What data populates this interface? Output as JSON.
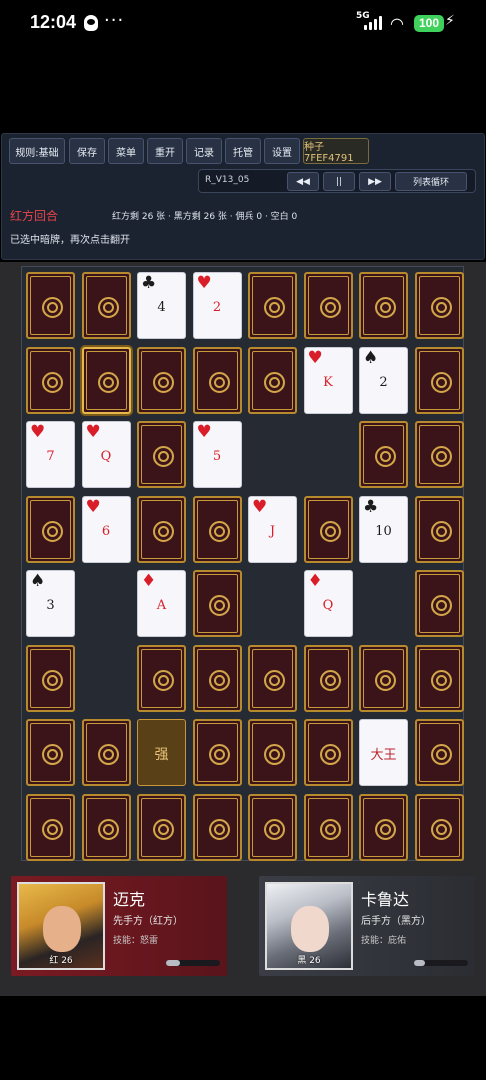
{
  "status": {
    "time": "12:04",
    "network": "5G",
    "battery": "100",
    "more": "···"
  },
  "toolbar": {
    "buttons": [
      "规则:基础",
      "保存",
      "菜单",
      "重开",
      "记录",
      "托管",
      "设置"
    ],
    "seed": "种子 7FEF4791"
  },
  "controls": {
    "version": "R_V13_05",
    "rewind": "◀◀",
    "pause": "||",
    "forward": "▶▶",
    "loop": "列表循环"
  },
  "info": {
    "turn": "红方回合",
    "counts": "红方剩 26 张 · 黑方剩 26 张 · 佣兵 0 · 空白 0",
    "message": "已选中暗牌，再次点击翻开"
  },
  "board": {
    "rows": [
      [
        {
          "t": "back"
        },
        {
          "t": "back"
        },
        {
          "t": "face",
          "suit": "♣",
          "rank": "4",
          "color": "black"
        },
        {
          "t": "face",
          "suit": "♥",
          "rank": "2",
          "color": "red"
        },
        {
          "t": "back"
        },
        {
          "t": "back"
        },
        {
          "t": "back"
        },
        {
          "t": "back"
        }
      ],
      [
        {
          "t": "back"
        },
        {
          "t": "back",
          "selected": true
        },
        {
          "t": "back"
        },
        {
          "t": "back"
        },
        {
          "t": "back"
        },
        {
          "t": "face",
          "suit": "♥",
          "rank": "K",
          "color": "red"
        },
        {
          "t": "face",
          "suit": "♠",
          "rank": "2",
          "color": "black"
        },
        {
          "t": "back"
        }
      ],
      [
        {
          "t": "face",
          "suit": "♥",
          "rank": "7",
          "color": "red"
        },
        {
          "t": "face",
          "suit": "♥",
          "rank": "Q",
          "color": "red"
        },
        {
          "t": "back"
        },
        {
          "t": "face",
          "suit": "♥",
          "rank": "5",
          "color": "red"
        },
        {
          "t": "empty"
        },
        {
          "t": "empty"
        },
        {
          "t": "back"
        },
        {
          "t": "back"
        }
      ],
      [
        {
          "t": "back"
        },
        {
          "t": "face",
          "suit": "♥",
          "rank": "6",
          "color": "red"
        },
        {
          "t": "back"
        },
        {
          "t": "back"
        },
        {
          "t": "face",
          "suit": "♥",
          "rank": "J",
          "color": "red"
        },
        {
          "t": "back"
        },
        {
          "t": "face",
          "suit": "♣",
          "rank": "10",
          "color": "black"
        },
        {
          "t": "back"
        }
      ],
      [
        {
          "t": "face",
          "suit": "♠",
          "rank": "3",
          "color": "black"
        },
        {
          "t": "empty"
        },
        {
          "t": "face",
          "suit": "♦",
          "rank": "A",
          "color": "red"
        },
        {
          "t": "back"
        },
        {
          "t": "empty"
        },
        {
          "t": "face",
          "suit": "♦",
          "rank": "Q",
          "color": "red"
        },
        {
          "t": "empty"
        },
        {
          "t": "back"
        }
      ],
      [
        {
          "t": "back"
        },
        {
          "t": "empty"
        },
        {
          "t": "back"
        },
        {
          "t": "back"
        },
        {
          "t": "back"
        },
        {
          "t": "back"
        },
        {
          "t": "back"
        },
        {
          "t": "back"
        }
      ],
      [
        {
          "t": "back"
        },
        {
          "t": "back"
        },
        {
          "t": "strong",
          "rank": "强"
        },
        {
          "t": "back"
        },
        {
          "t": "back"
        },
        {
          "t": "back"
        },
        {
          "t": "joker",
          "rank": "大王"
        },
        {
          "t": "back"
        }
      ],
      [
        {
          "t": "back"
        },
        {
          "t": "back"
        },
        {
          "t": "back"
        },
        {
          "t": "back"
        },
        {
          "t": "back"
        },
        {
          "t": "back"
        },
        {
          "t": "back"
        },
        {
          "t": "back"
        }
      ]
    ]
  },
  "players": [
    {
      "name": "迈克",
      "role": "先手方（红方）",
      "skill": "技能：怒雷",
      "tag": "红 26",
      "progress": 0.25
    },
    {
      "name": "卡鲁达",
      "role": "后手方（黑方）",
      "skill": "技能：庇佑",
      "tag": "黑 26",
      "progress": 0.2
    }
  ]
}
